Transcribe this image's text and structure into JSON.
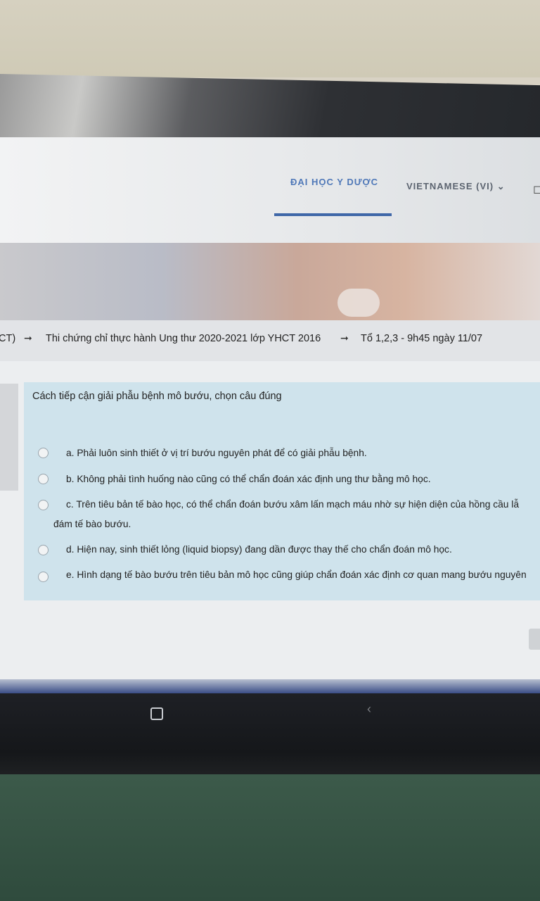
{
  "nav": {
    "home_label": "ĐẠI HỌC Y DƯỢC",
    "language_label": "VIETNAMESE (VI)",
    "language_chevron": "⌄",
    "edge_icon": "◻"
  },
  "breadcrumb": {
    "items": [
      "CT)",
      "Thi chứng chỉ thực hành Ung thư 2020-2021 lớp YHCT 2016",
      "Tổ 1,2,3 - 9h45 ngày 11/07"
    ],
    "separator": "➞"
  },
  "question": {
    "text": "Cách tiếp cận giải phẫu bệnh mô bướu, chọn câu đúng",
    "options": [
      "a. Phải luôn sinh thiết ở vị trí bướu nguyên phát để có giải phẫu bệnh.",
      "b. Không phải tình huống nào cũng có thể chẩn đoán xác định ung thư bằng mô học.",
      "c. Trên tiêu bản tế bào học, có thể chẩn đoán bướu xâm lấn mạch máu nhờ sự hiện diện của hồng cầu lẫ",
      "d. Hiện nay, sinh thiết lỏng (liquid biopsy) đang dần được thay thế cho chẩn đoán mô học.",
      "e. Hình dạng tế bào bướu trên tiêu bản mô học cũng giúp chẩn đoán xác định cơ quan mang bướu nguyên"
    ],
    "option_c_continuation": "đám tế bào bướu."
  },
  "device": {
    "back_glyph": "‹"
  }
}
